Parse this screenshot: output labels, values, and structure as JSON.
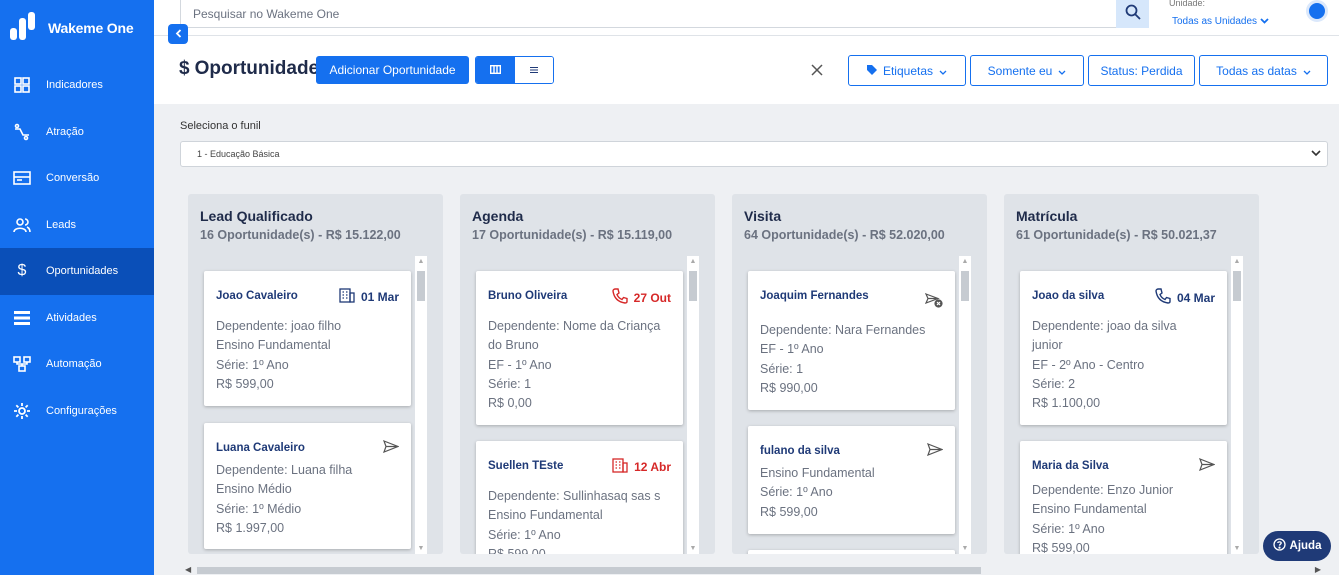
{
  "app": {
    "name": "Wakeme One"
  },
  "sidebar": {
    "items": [
      {
        "label": "Indicadores",
        "icon": "dashboard-icon"
      },
      {
        "label": "Atração",
        "icon": "attraction-icon"
      },
      {
        "label": "Conversão",
        "icon": "conversion-icon"
      },
      {
        "label": "Leads",
        "icon": "users-icon"
      },
      {
        "label": "Oportunidades",
        "icon": "dollar-icon",
        "active": true
      },
      {
        "label": "Atividades",
        "icon": "list-icon"
      },
      {
        "label": "Automação",
        "icon": "automation-icon"
      },
      {
        "label": "Configurações",
        "icon": "gear-icon"
      }
    ]
  },
  "topbar": {
    "search_placeholder": "Pesquisar no Wakeme One",
    "unit_label": "Unidade:",
    "unit_value": "Todas as Unidades"
  },
  "header": {
    "title": "Oportunidade",
    "title_symbol": "$",
    "add_button": "Adicionar Oportunidade",
    "filters": {
      "tags": "Etiquetas",
      "only_me": "Somente eu",
      "status": "Status: Perdida",
      "dates": "Todas as datas"
    }
  },
  "funnel": {
    "label": "Seleciona o funil",
    "selected": "1 - Educação Básica"
  },
  "columns": [
    {
      "title": "Lead Qualificado",
      "summary": "16 Oportunidade(s) - R$ 15.122,00",
      "cards": [
        {
          "name": "Joao Cavaleiro",
          "meta_icon": "building-icon",
          "date": "01 Mar",
          "lines": [
            "Dependente: joao filho",
            "Ensino Fundamental",
            "Série: 1º Ano",
            "R$ 599,00"
          ]
        },
        {
          "name": "Luana Cavaleiro",
          "meta_icon": "send-icon",
          "date": "",
          "lines": [
            "Dependente: Luana filha",
            "Ensino Médio",
            "Série: 1º Médio",
            "R$ 1.997,00"
          ]
        }
      ]
    },
    {
      "title": "Agenda",
      "summary": "17 Oportunidade(s) - R$ 15.119,00",
      "cards": [
        {
          "name": "Bruno Oliveira",
          "meta_icon": "phone-icon",
          "date": "27 Out",
          "lines": [
            "Dependente: Nome da Criança",
            "do Bruno",
            "EF - 1º Ano",
            "Série: 1",
            "R$ 0,00"
          ]
        },
        {
          "name": "Suellen TEste",
          "meta_icon": "building-icon",
          "date": "12 Abr",
          "lines": [
            "Dependente: Sullinhasaq sas s",
            "Ensino Fundamental",
            "Série: 1º Ano",
            "R$ 599,00"
          ]
        }
      ]
    },
    {
      "title": "Visita",
      "summary": "64 Oportunidade(s) - R$ 52.020,00",
      "cards": [
        {
          "name": "Joaquim Fernandes",
          "meta_icon": "send-cancel-icon",
          "date": "",
          "lines": [
            "Dependente: Nara Fernandes",
            "EF - 1º Ano",
            "Série: 1",
            "R$ 990,00"
          ]
        },
        {
          "name": "fulano da silva",
          "meta_icon": "send-icon",
          "date": "",
          "lines": [
            "Ensino Fundamental",
            "Série: 1º Ano",
            "R$ 599,00"
          ]
        }
      ]
    },
    {
      "title": "Matrícula",
      "summary": "61 Oportunidade(s) - R$ 50.021,37",
      "cards": [
        {
          "name": "Joao da silva",
          "meta_icon": "phone-icon",
          "date": "04 Mar",
          "lines": [
            "Dependente: joao da silva",
            "junior",
            "EF - 2º Ano - Centro",
            "Série: 2",
            "R$ 1.100,00"
          ]
        },
        {
          "name": "Maria da Silva",
          "meta_icon": "send-icon",
          "date": "",
          "lines": [
            "Dependente: Enzo Junior",
            "Ensino Fundamental",
            "Série: 1º Ano",
            "R$ 599,00"
          ]
        }
      ]
    }
  ],
  "help": {
    "label": "Ajuda"
  },
  "colors": {
    "primary": "#1570ef",
    "sidebar_active": "#0a4fb8",
    "overdue": "#d62828",
    "navy": "#1f3a77"
  }
}
